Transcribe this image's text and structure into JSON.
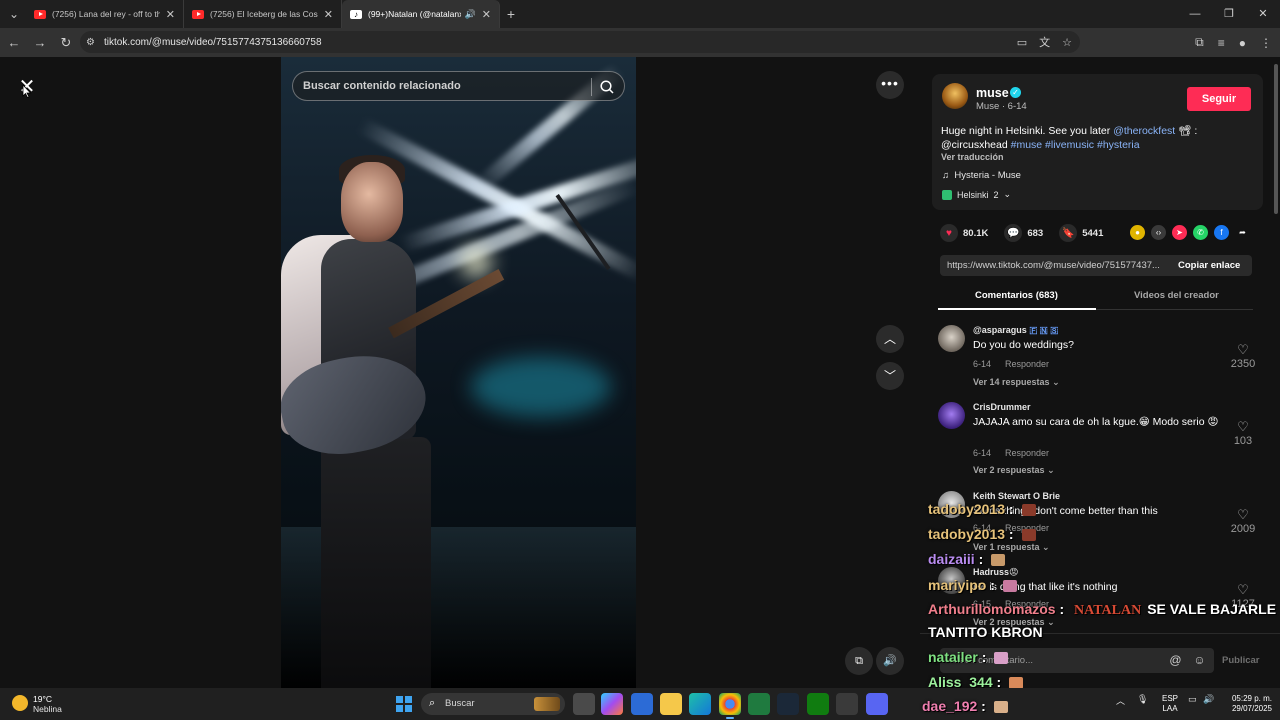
{
  "browser": {
    "tabs": [
      {
        "title": "(7256) Lana del rey - off to the",
        "icon": "youtube-icon",
        "active": false
      },
      {
        "title": "(7256) El Iceberg de las Cosas r",
        "icon": "youtube-icon",
        "active": false
      },
      {
        "title": "(99+)Natalan (@natalanx) |",
        "icon": "tiktok-icon",
        "active": true,
        "audio": true
      }
    ],
    "url": "tiktok.com/@muse/video/7515774375136660758"
  },
  "video": {
    "search_placeholder": "Buscar contenido relacionado"
  },
  "post": {
    "username": "muse",
    "nickname_date": "Muse · 6-14",
    "follow_label": "Seguir",
    "desc_1": "Huge night in Helsinki. See you later ",
    "mention_1": "@therockfest",
    "desc_2": " 📽 : @circusxhead ",
    "hashtag_1": "#muse",
    "hashtag_2": "#livemusic",
    "hashtag_3": "#hysteria",
    "translate": "Ver traducción",
    "music": "Hysteria - Muse",
    "location": "Helsinki",
    "location_count": "2",
    "likes": "80.1K",
    "comments": "683",
    "saves": "5441",
    "link": "https://www.tiktok.com/@muse/video/751577437...",
    "copy_label": "Copiar enlace",
    "tab_comments": "Comentarios (683)",
    "tab_creator": "Videos del creador"
  },
  "comments": [
    {
      "user": "@asparagus",
      "badges": "🇫 🇳 🇸",
      "text": "Do you do weddings?",
      "date": "6-14",
      "reply": "Responder",
      "replies": "Ver 14 respuestas",
      "likes": "2350"
    },
    {
      "user": "CrisDrummer",
      "text": "JAJAJA amo su cara de oh la kgue.😁 Modo serio 😡",
      "date": "6-14",
      "reply": "Responder",
      "replies": "Ver 2 respuestas",
      "likes": "103"
    },
    {
      "user": "Keith Stewart O Brie",
      "text": "Some things don't come better than this",
      "date": "6-14",
      "reply": "Responder",
      "replies": "Ver 1 respuesta",
      "likes": "2009"
    },
    {
      "user": "Hadruss😡",
      "text": "He is doing that like it's nothing",
      "date": "6-15",
      "reply": "Responder",
      "replies": "Ver 2 respuestas",
      "likes": "1127"
    }
  ],
  "comment_box": {
    "placeholder": "Añadir comentario...",
    "publish": "Publicar"
  },
  "chat": [
    {
      "user": "tadoby2013",
      "color": "#e6c27a",
      "msg": ""
    },
    {
      "user": "tadoby2013",
      "color": "#e6c27a",
      "msg": ""
    },
    {
      "user": "daizaiii",
      "color": "#b98cf0",
      "msg": ""
    },
    {
      "user": "mariyipo",
      "color": "#e6c27a",
      "msg": ""
    },
    {
      "user": "Arthurillomomazos",
      "color": "#f07f8c",
      "natalan": "NATALAN",
      "msg": "SE VALE BAJARLE",
      "msg2": "TANTITO KBRON"
    },
    {
      "user": "natailer",
      "color": "#7ee081",
      "msg": ""
    },
    {
      "user": "Aliss_344",
      "color": "#9cf09c",
      "msg": ""
    },
    {
      "user": "dae_192",
      "color": "#f07fb0",
      "msg": ""
    }
  ],
  "taskbar": {
    "temp": "19°C",
    "condition": "Neblina",
    "search": "Buscar",
    "lang_1": "ESP",
    "lang_2": "LAA",
    "time": "05:29 p. m.",
    "date": "29/07/2025"
  }
}
